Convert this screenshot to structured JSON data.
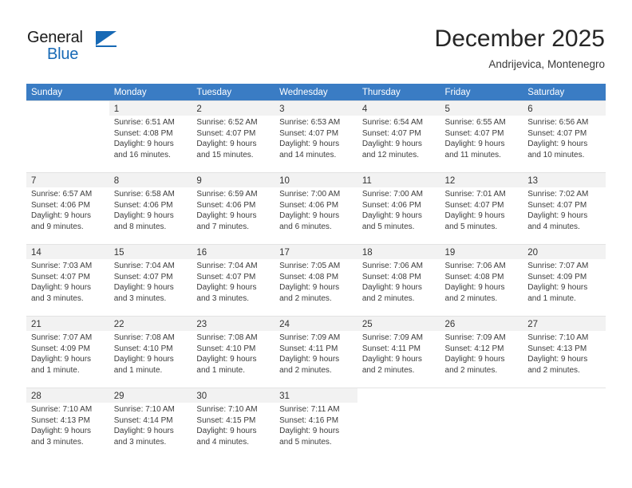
{
  "brand": {
    "name_part1": "General",
    "name_part2": "Blue",
    "logo_icon": "triangle-logo-icon",
    "accent_color": "#1769b5"
  },
  "header": {
    "title": "December 2025",
    "location": "Andrijevica, Montenegro"
  },
  "calendar": {
    "header_bg": "#3a7cc4",
    "shaded_cell_bg": "#f2f2f2",
    "weekdays": [
      "Sunday",
      "Monday",
      "Tuesday",
      "Wednesday",
      "Thursday",
      "Friday",
      "Saturday"
    ],
    "weeks": [
      [
        {
          "day": "",
          "sunrise": "",
          "sunset": "",
          "daylight1": "",
          "daylight2": "",
          "empty": true
        },
        {
          "day": "1",
          "sunrise": "Sunrise: 6:51 AM",
          "sunset": "Sunset: 4:08 PM",
          "daylight1": "Daylight: 9 hours",
          "daylight2": "and 16 minutes."
        },
        {
          "day": "2",
          "sunrise": "Sunrise: 6:52 AM",
          "sunset": "Sunset: 4:07 PM",
          "daylight1": "Daylight: 9 hours",
          "daylight2": "and 15 minutes."
        },
        {
          "day": "3",
          "sunrise": "Sunrise: 6:53 AM",
          "sunset": "Sunset: 4:07 PM",
          "daylight1": "Daylight: 9 hours",
          "daylight2": "and 14 minutes."
        },
        {
          "day": "4",
          "sunrise": "Sunrise: 6:54 AM",
          "sunset": "Sunset: 4:07 PM",
          "daylight1": "Daylight: 9 hours",
          "daylight2": "and 12 minutes."
        },
        {
          "day": "5",
          "sunrise": "Sunrise: 6:55 AM",
          "sunset": "Sunset: 4:07 PM",
          "daylight1": "Daylight: 9 hours",
          "daylight2": "and 11 minutes."
        },
        {
          "day": "6",
          "sunrise": "Sunrise: 6:56 AM",
          "sunset": "Sunset: 4:07 PM",
          "daylight1": "Daylight: 9 hours",
          "daylight2": "and 10 minutes."
        }
      ],
      [
        {
          "day": "7",
          "sunrise": "Sunrise: 6:57 AM",
          "sunset": "Sunset: 4:06 PM",
          "daylight1": "Daylight: 9 hours",
          "daylight2": "and 9 minutes."
        },
        {
          "day": "8",
          "sunrise": "Sunrise: 6:58 AM",
          "sunset": "Sunset: 4:06 PM",
          "daylight1": "Daylight: 9 hours",
          "daylight2": "and 8 minutes."
        },
        {
          "day": "9",
          "sunrise": "Sunrise: 6:59 AM",
          "sunset": "Sunset: 4:06 PM",
          "daylight1": "Daylight: 9 hours",
          "daylight2": "and 7 minutes."
        },
        {
          "day": "10",
          "sunrise": "Sunrise: 7:00 AM",
          "sunset": "Sunset: 4:06 PM",
          "daylight1": "Daylight: 9 hours",
          "daylight2": "and 6 minutes."
        },
        {
          "day": "11",
          "sunrise": "Sunrise: 7:00 AM",
          "sunset": "Sunset: 4:06 PM",
          "daylight1": "Daylight: 9 hours",
          "daylight2": "and 5 minutes."
        },
        {
          "day": "12",
          "sunrise": "Sunrise: 7:01 AM",
          "sunset": "Sunset: 4:07 PM",
          "daylight1": "Daylight: 9 hours",
          "daylight2": "and 5 minutes."
        },
        {
          "day": "13",
          "sunrise": "Sunrise: 7:02 AM",
          "sunset": "Sunset: 4:07 PM",
          "daylight1": "Daylight: 9 hours",
          "daylight2": "and 4 minutes."
        }
      ],
      [
        {
          "day": "14",
          "sunrise": "Sunrise: 7:03 AM",
          "sunset": "Sunset: 4:07 PM",
          "daylight1": "Daylight: 9 hours",
          "daylight2": "and 3 minutes."
        },
        {
          "day": "15",
          "sunrise": "Sunrise: 7:04 AM",
          "sunset": "Sunset: 4:07 PM",
          "daylight1": "Daylight: 9 hours",
          "daylight2": "and 3 minutes."
        },
        {
          "day": "16",
          "sunrise": "Sunrise: 7:04 AM",
          "sunset": "Sunset: 4:07 PM",
          "daylight1": "Daylight: 9 hours",
          "daylight2": "and 3 minutes."
        },
        {
          "day": "17",
          "sunrise": "Sunrise: 7:05 AM",
          "sunset": "Sunset: 4:08 PM",
          "daylight1": "Daylight: 9 hours",
          "daylight2": "and 2 minutes."
        },
        {
          "day": "18",
          "sunrise": "Sunrise: 7:06 AM",
          "sunset": "Sunset: 4:08 PM",
          "daylight1": "Daylight: 9 hours",
          "daylight2": "and 2 minutes."
        },
        {
          "day": "19",
          "sunrise": "Sunrise: 7:06 AM",
          "sunset": "Sunset: 4:08 PM",
          "daylight1": "Daylight: 9 hours",
          "daylight2": "and 2 minutes."
        },
        {
          "day": "20",
          "sunrise": "Sunrise: 7:07 AM",
          "sunset": "Sunset: 4:09 PM",
          "daylight1": "Daylight: 9 hours",
          "daylight2": "and 1 minute."
        }
      ],
      [
        {
          "day": "21",
          "sunrise": "Sunrise: 7:07 AM",
          "sunset": "Sunset: 4:09 PM",
          "daylight1": "Daylight: 9 hours",
          "daylight2": "and 1 minute."
        },
        {
          "day": "22",
          "sunrise": "Sunrise: 7:08 AM",
          "sunset": "Sunset: 4:10 PM",
          "daylight1": "Daylight: 9 hours",
          "daylight2": "and 1 minute."
        },
        {
          "day": "23",
          "sunrise": "Sunrise: 7:08 AM",
          "sunset": "Sunset: 4:10 PM",
          "daylight1": "Daylight: 9 hours",
          "daylight2": "and 1 minute."
        },
        {
          "day": "24",
          "sunrise": "Sunrise: 7:09 AM",
          "sunset": "Sunset: 4:11 PM",
          "daylight1": "Daylight: 9 hours",
          "daylight2": "and 2 minutes."
        },
        {
          "day": "25",
          "sunrise": "Sunrise: 7:09 AM",
          "sunset": "Sunset: 4:11 PM",
          "daylight1": "Daylight: 9 hours",
          "daylight2": "and 2 minutes."
        },
        {
          "day": "26",
          "sunrise": "Sunrise: 7:09 AM",
          "sunset": "Sunset: 4:12 PM",
          "daylight1": "Daylight: 9 hours",
          "daylight2": "and 2 minutes."
        },
        {
          "day": "27",
          "sunrise": "Sunrise: 7:10 AM",
          "sunset": "Sunset: 4:13 PM",
          "daylight1": "Daylight: 9 hours",
          "daylight2": "and 2 minutes."
        }
      ],
      [
        {
          "day": "28",
          "sunrise": "Sunrise: 7:10 AM",
          "sunset": "Sunset: 4:13 PM",
          "daylight1": "Daylight: 9 hours",
          "daylight2": "and 3 minutes."
        },
        {
          "day": "29",
          "sunrise": "Sunrise: 7:10 AM",
          "sunset": "Sunset: 4:14 PM",
          "daylight1": "Daylight: 9 hours",
          "daylight2": "and 3 minutes."
        },
        {
          "day": "30",
          "sunrise": "Sunrise: 7:10 AM",
          "sunset": "Sunset: 4:15 PM",
          "daylight1": "Daylight: 9 hours",
          "daylight2": "and 4 minutes."
        },
        {
          "day": "31",
          "sunrise": "Sunrise: 7:11 AM",
          "sunset": "Sunset: 4:16 PM",
          "daylight1": "Daylight: 9 hours",
          "daylight2": "and 5 minutes."
        },
        {
          "day": "",
          "sunrise": "",
          "sunset": "",
          "daylight1": "",
          "daylight2": "",
          "empty": true
        },
        {
          "day": "",
          "sunrise": "",
          "sunset": "",
          "daylight1": "",
          "daylight2": "",
          "empty": true
        },
        {
          "day": "",
          "sunrise": "",
          "sunset": "",
          "daylight1": "",
          "daylight2": "",
          "empty": true
        }
      ]
    ]
  }
}
